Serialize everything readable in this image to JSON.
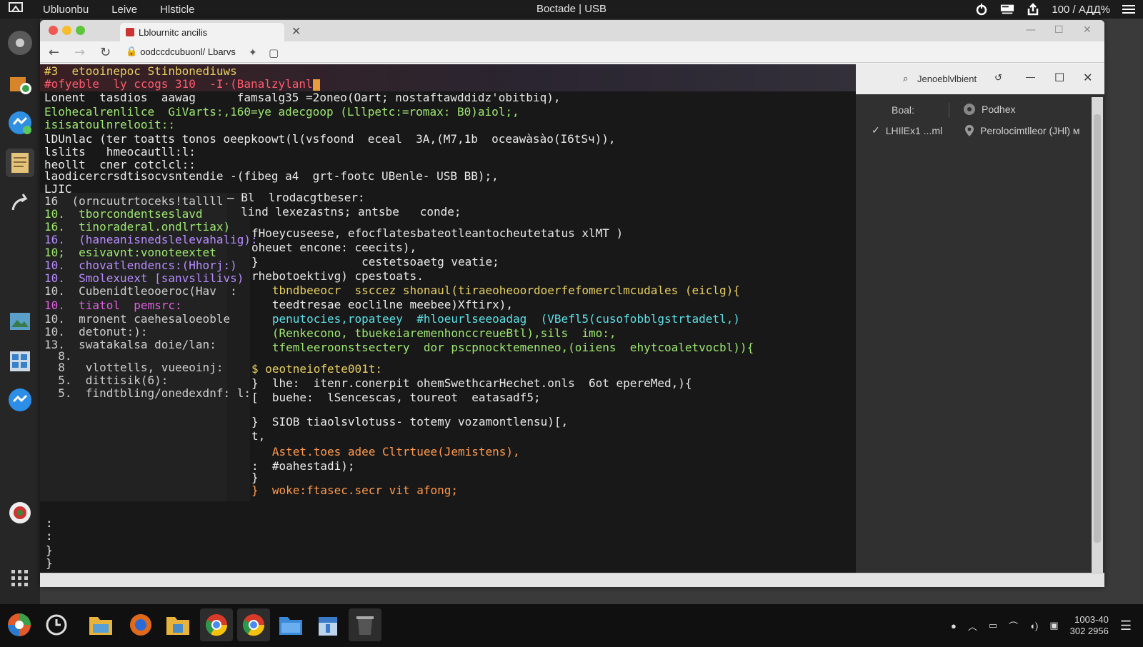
{
  "top_panel": {
    "logo": "🖥",
    "menus": [
      "Ubluonbu",
      "Leive",
      "Hlsticle"
    ],
    "center_title": "Boctade | USB",
    "status": "100 / АДД%"
  },
  "browser": {
    "tab_title": "Lblournitc ancilis",
    "url": "oodccdcubuonl/ Lbarvs",
    "colors": {
      "close": "#ee5a52",
      "minimize": "#f6be2b",
      "maximize": "#5fc63b"
    }
  },
  "terminal": {
    "header_lines": [
      "#3  etooinepoc Stinbonediuws",
      "#ofyeble  ly ccogs 310  -I·(Banalzylanl"
    ],
    "lines": [
      "Lonent  tasdios  aawag      famsalg35 =2oneo(Oart; nostaftawddidz'obitbiq),",
      "Elohecalrenlilce  GiVarts:,160=ye adecgoop (Lllpetc:=romax: B0)aiol;,",
      "isisatoulnrelooit::",
      "lDUnlac (ter toatts tonos oeepkoowt(l(vsfoond  eceal  3A,(М7,1b  oceawàsào(I6tSч)),",
      "lslits   hmeocautll:l:",
      "heollt  cner cotclcl::",
      "laodicercrsdtisocvsntendie -(fibeg a4  grt-footc UBenle- USB BB);,",
      "LJІC"
    ],
    "left_pane_lines": [
      "16  (orncuutrtoceks!tallll",
      "10.  tborcondentseslavd",
      "16.  tinoraderal.ondlrtiax)",
      "16.  (haneanisnedslelevahalig):",
      "10;  esivavnt:vonoteextet",
      "10.  chovatlendencs:(Hhorj:)",
      "10.  Smolexuext [sanvslilivs)",
      "10.  Cubenidtleooeroc(Hav  :",
      "10.  tiatol  pemsrc:",
      "10.  mronent caehesaloeoble",
      "10.  detonut:):",
      "13.  swatakalsa doie/lan:",
      "  8.",
      "  8   vlottells, vueeoinj:",
      "  5.  dittisik(6):",
      "  5.  findtbling/onedexdnf: l:"
    ],
    "code_lines": [
      "̶ Bl  lrodacgtbeser:",
      "  lind lexezastns; antsbe   conde;",
      "fHoeycuseese, efocflatesbateotleantocheutetatus хlMT )",
      "oheuet encone: ceecits),",
      "}               cestetsoaetg veatie;",
      "rhebotoektivg) cpestoats.",
      "   tbndbeeocr  ssccez shonaul(tiraeoheoordoerfefomerclmcudales (eiclg){",
      "   teedtresae eoclilne meebee)Хftirx),",
      "   penutocies,ropateey  #hloeurlseeoadag  (VBefl5(cusofobblgstrtadetl,)",
      "   (Renkecono, tbuekeiaremenhonccreueBtl),sils  imo:,",
      "   tfemleeroonstsectery  dor pscpnocktemenneo,(oiiens  ehytcoaletvocbl)){",
      "$ oeotneiofete001t:",
      "}  lhe:  itenr.conerpit ohemSwethcarHechet.onls  6ot epereMed,){",
      "[  buehe:  lSencescas, toureot  eatasadf5;",
      "}  SIOB tiaolsvlotuss- totemy vozamontlensu)[,",
      "t,",
      "   Astet.toes adee Cltrtuee(Jemistens),",
      ":  #oahestadi);",
      "}",
      "}  woke:ftasec.secr vit afong;"
    ],
    "tail_lines": [
      ":",
      ":",
      "}",
      "}"
    ]
  },
  "side_panel": {
    "search_label": "Jenoeblvlbient",
    "row1_left": "Boal:",
    "row1_right": "Podhex",
    "row2_left": "LHIlEx1 ...ml",
    "row2_right": "Perolocimtlleor (JHl) м"
  },
  "taskbar": {
    "clock_time": "1003-40",
    "clock_date": "302 2956"
  }
}
